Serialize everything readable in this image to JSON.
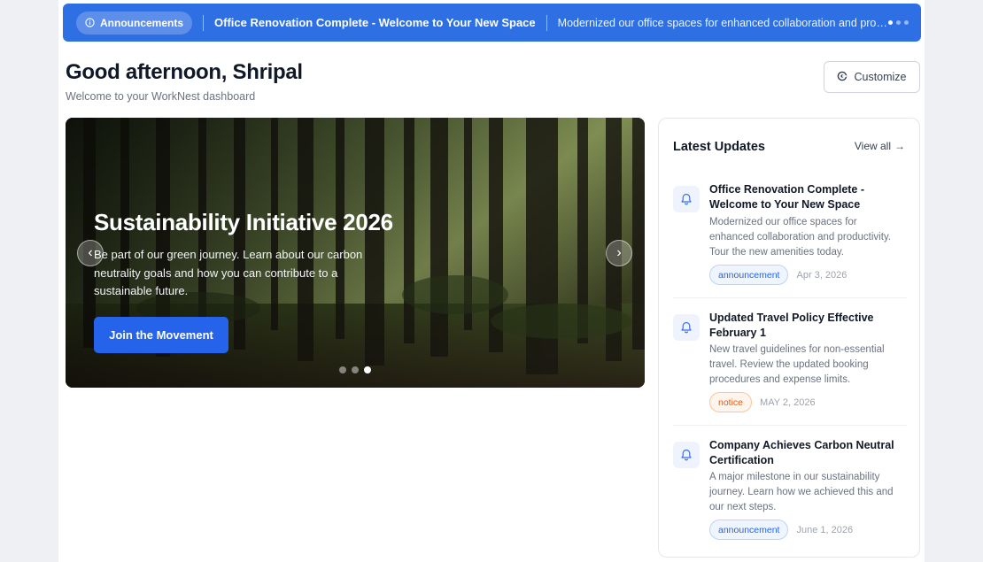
{
  "announcement_bar": {
    "badge_label": "Announcements",
    "title": "Office Renovation Complete - Welcome to Your New Space",
    "description": "Modernized our office spaces for enhanced collaboration and productivity. Tour the new amenities today.",
    "dots_total": 3,
    "dots_active": 1
  },
  "header": {
    "greeting": "Good afternoon, Shripal",
    "subtitle": "Welcome to your WorkNest dashboard",
    "customize_label": "Customize"
  },
  "hero": {
    "title": "Sustainability Initiative 2026",
    "text": "Be part of our green journey. Learn about our carbon neutrality goals and how you can contribute to a sustainable future.",
    "button_label": "Join the Movement",
    "prev_glyph": "‹",
    "next_glyph": "›",
    "slides_total": 3,
    "active_slide": 3
  },
  "updates": {
    "heading": "Latest Updates",
    "view_all_label": "View all",
    "view_all_arrow": "→",
    "items": [
      {
        "title": "Office Renovation Complete - Welcome to Your New Space",
        "description": "Modernized our office spaces for enhanced collaboration and productivity. Tour the new amenities today.",
        "tag": "announcement",
        "date": "Apr 3, 2026"
      },
      {
        "title": "Updated Travel Policy Effective February 1",
        "description": "New travel guidelines for non-essential travel. Review the updated booking procedures and expense limits.",
        "tag": "notice",
        "date": "MAY 2, 2026"
      },
      {
        "title": "Company Achieves Carbon Neutral Certification",
        "description": "A major milestone in our sustainability journey. Learn how we achieved this and our next steps.",
        "tag": "announcement",
        "date": "June 1, 2026"
      }
    ]
  },
  "colors": {
    "accent": "#2f6fe4",
    "button_blue": "#2563eb",
    "tag_announcement": "#2563eb",
    "tag_notice": "#ea580c"
  },
  "icons": {
    "announcement": "info-icon",
    "customize": "customize-icon",
    "update_item": "bell-icon"
  }
}
